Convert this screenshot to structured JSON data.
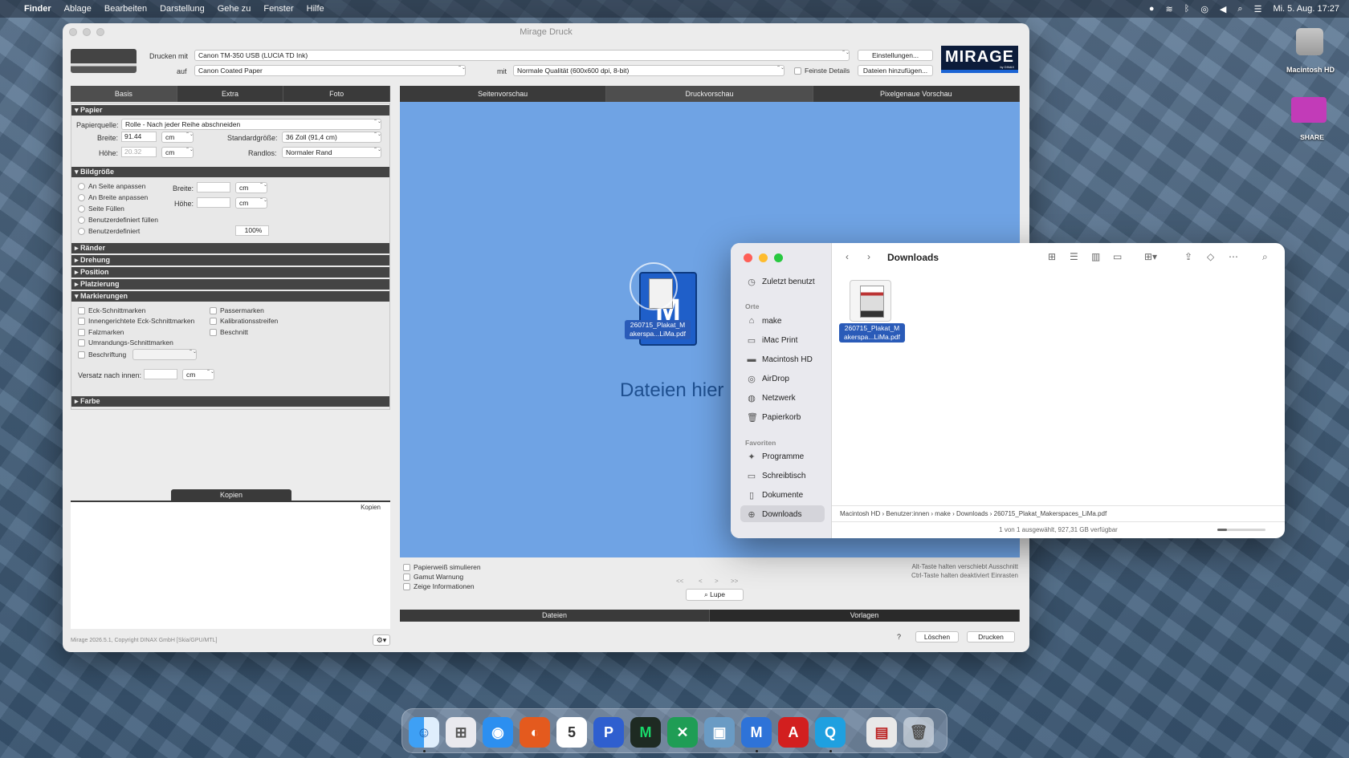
{
  "menubar": {
    "app": "Finder",
    "items": [
      "Ablage",
      "Bearbeiten",
      "Darstellung",
      "Gehe zu",
      "Fenster",
      "Hilfe"
    ],
    "datetime": "Mi. 5. Aug. 17:27"
  },
  "mirage": {
    "title": "Mirage Druck",
    "print_with_label": "Drucken mit",
    "printer": "Canon TM-350 USB (LUCIA TD Ink)",
    "settings_button": "Einstellungen...",
    "on_label": "auf",
    "paper": "Canon Coated Paper",
    "with_label": "mit",
    "quality": "Normale Qualität (600x600 dpi, 8-bit)",
    "finest_details": "Feinste Details",
    "add_files_button": "Dateien hinzufügen...",
    "logo": "MIRAGE",
    "logo_sub": "by DINAX",
    "left_tabs": [
      "Basis",
      "Extra",
      "Foto"
    ],
    "papier": {
      "header": "Papier",
      "source_label": "Papierquelle:",
      "source_value": "Rolle - Nach jeder Reihe abschneiden",
      "width_label": "Breite:",
      "width_value": "91.44",
      "unit": "cm",
      "std_size_label": "Standardgröße:",
      "std_size_value": "36 Zoll (91,4 cm)",
      "height_label": "Höhe:",
      "height_value": "20.32",
      "borderless_label": "Randlos:",
      "borderless_value": "Normaler Rand"
    },
    "bildgroesse": {
      "header": "Bildgröße",
      "options": [
        "An Seite anpassen",
        "An Breite anpassen",
        "Seite Füllen",
        "Benutzerdefiniert füllen",
        "Benutzerdefiniert"
      ],
      "width_label": "Breite:",
      "height_label": "Höhe:",
      "unit": "cm",
      "percent": "100%"
    },
    "collapsed_sections": [
      "Ränder",
      "Drehung",
      "Position",
      "Platzierung"
    ],
    "markierungen": {
      "header": "Markierungen",
      "left": [
        "Eck-Schnittmarken",
        "Innengerichtete Eck-Schnittmarken",
        "Falzmarken",
        "Umrandungs-Schnittmarken",
        "Beschriftung"
      ],
      "right": [
        "Passermarken",
        "Kalibrationsstreifen",
        "Beschnitt"
      ],
      "offset_label": "Versatz nach innen:",
      "unit": "cm"
    },
    "farbe_header": "Farbe",
    "copies_tab": "Kopien",
    "copies_column": "Kopien",
    "copyright": "Mirage 2026.5.1, Copyright DINAX GmbH [Skia/GPU/MTL]",
    "preview_tabs": [
      "Seitenvorschau",
      "Druckvorschau",
      "Pixelgenaue Vorschau"
    ],
    "drop_text": "Dateien hier",
    "drag_file": "260715_Plakat_M akerspa...LiMa.pdf",
    "options": [
      "Papierweiß simulieren",
      "Gamut Warnung",
      "Zeige Informationen"
    ],
    "hint1": "Alt-Taste halten verschiebt Ausschnitt",
    "hint2": "Ctrl-Taste halten deaktiviert Einrasten",
    "nav": [
      "<<",
      "<",
      ">",
      ">>"
    ],
    "lupe": "Lupe",
    "bottom_tabs": [
      "Dateien",
      "Vorlagen"
    ],
    "help": "?",
    "delete_button": "Löschen",
    "print_button": "Drucken"
  },
  "finder": {
    "title": "Downloads",
    "recent": "Zuletzt benutzt",
    "places_header": "Orte",
    "places": [
      "make",
      "iMac Print",
      "Macintosh HD",
      "AirDrop",
      "Netzwerk",
      "Papierkorb"
    ],
    "favorites_header": "Favoriten",
    "favorites": [
      "Programme",
      "Schreibtisch",
      "Dokumente",
      "Downloads"
    ],
    "file_label": "260715_Plakat_M akerspa...LiMa.pdf",
    "path": [
      "Macintosh HD",
      "Benutzer:innen",
      "make",
      "Downloads",
      "260715_Plakat_Makerspaces_LiMa.pdf"
    ],
    "status": "1 von 1 ausgewählt, 927,31 GB verfügbar"
  },
  "desktop": {
    "hd_label": "Macintosh HD",
    "share_label": "SHARE"
  },
  "dock": {
    "calendar_day": "5"
  }
}
